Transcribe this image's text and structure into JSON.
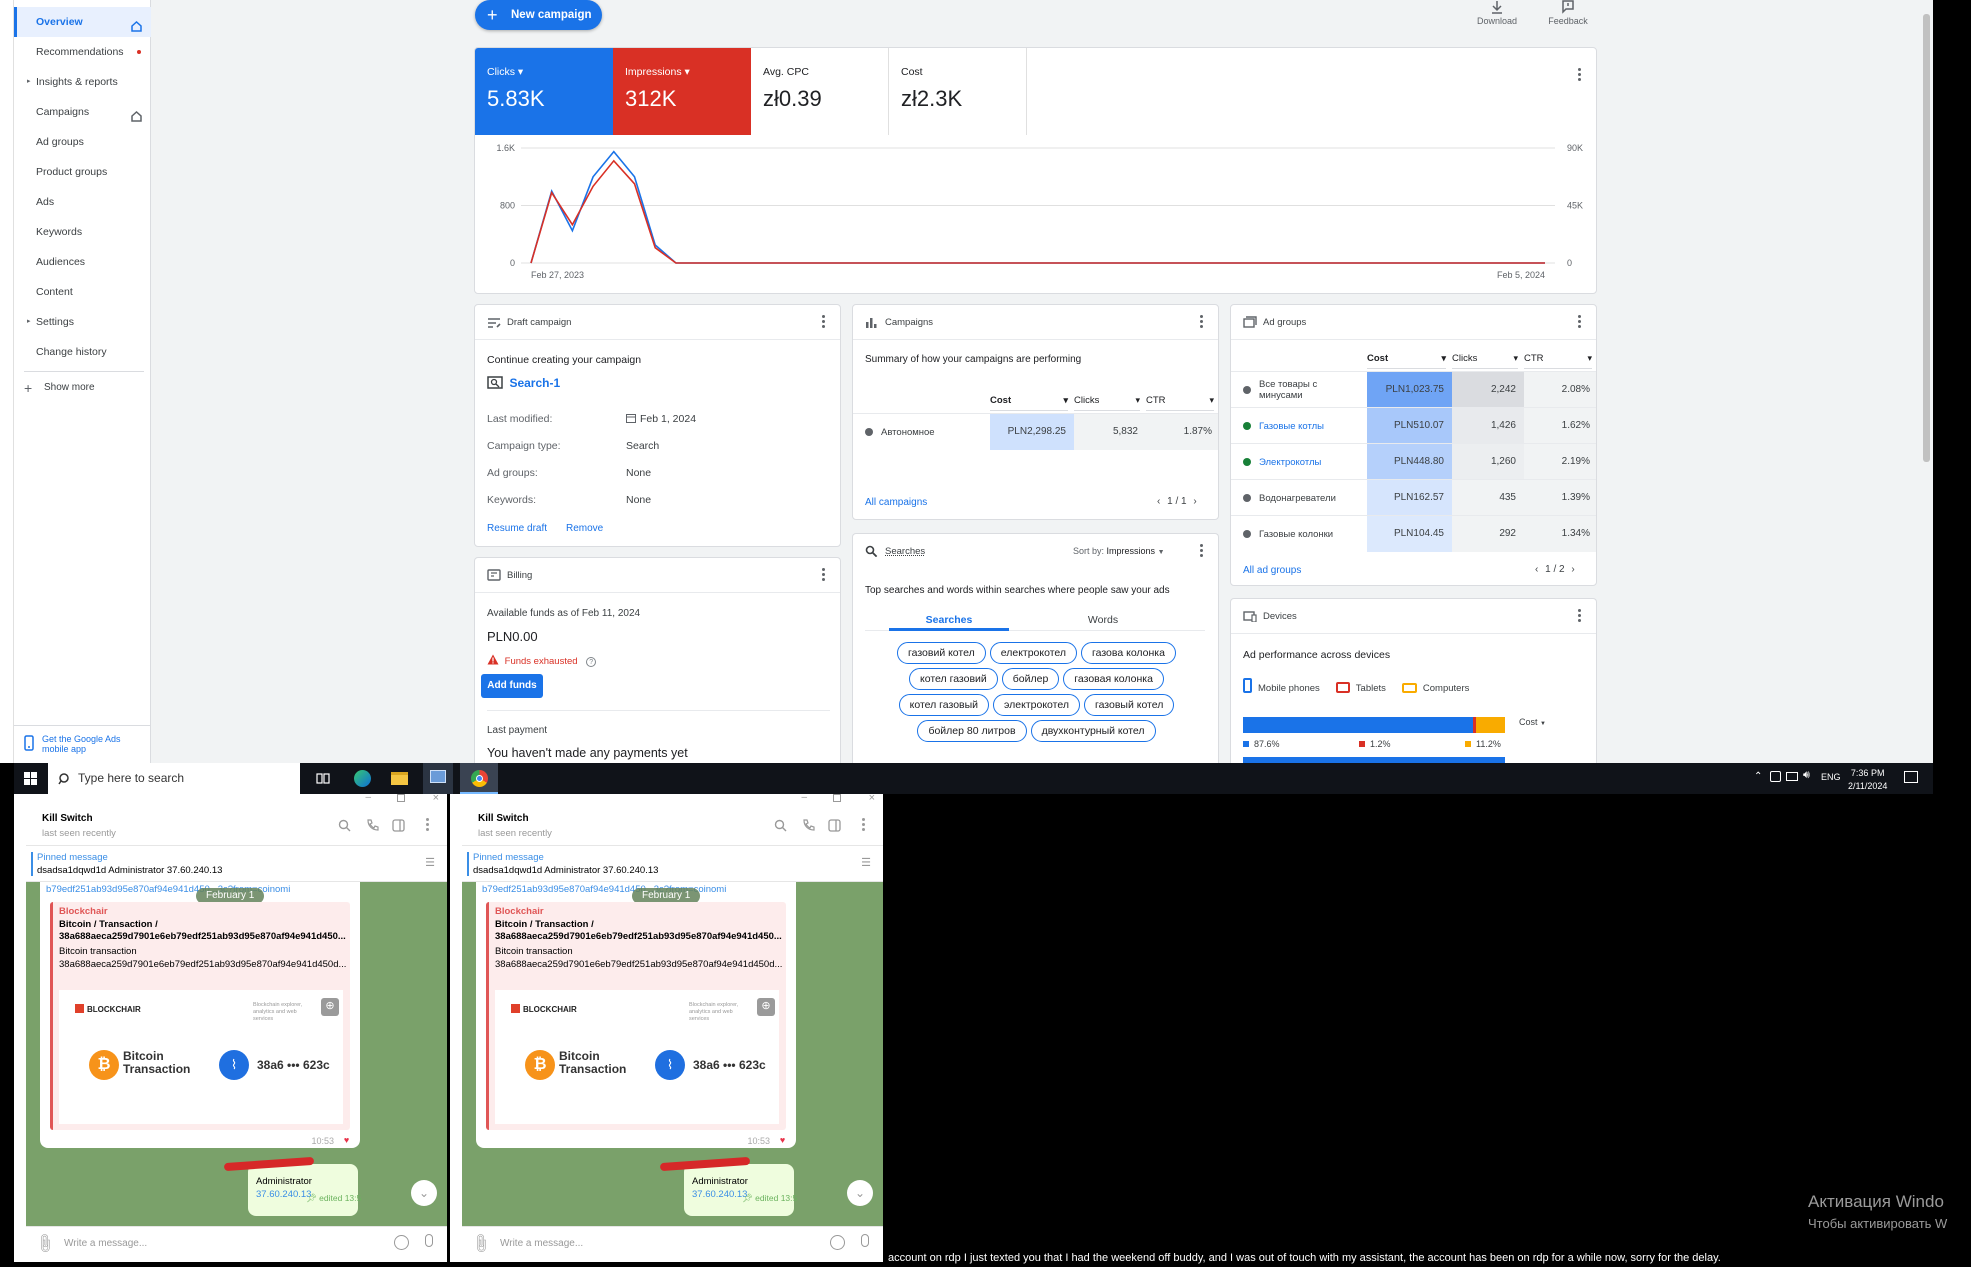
{
  "sidebar": {
    "items": [
      {
        "label": "Overview",
        "active": true,
        "icon": "home-icon"
      },
      {
        "label": "Recommendations",
        "badge": "red-dot"
      },
      {
        "label": "Insights & reports",
        "expandable": true
      },
      {
        "label": "Campaigns",
        "icon": "home-icon"
      },
      {
        "label": "Ad groups"
      },
      {
        "label": "Product groups"
      },
      {
        "label": "Ads"
      },
      {
        "label": "Keywords"
      },
      {
        "label": "Audiences"
      },
      {
        "label": "Content"
      },
      {
        "label": "Settings",
        "expandable": true
      },
      {
        "label": "Change history"
      }
    ],
    "show_more": "Show more",
    "app_promo": "Get the Google Ads mobile app"
  },
  "toolbar": {
    "new_campaign": "New campaign",
    "download": "Download",
    "feedback": "Feedback"
  },
  "metrics": [
    {
      "label": "Clicks",
      "value": "5.83K",
      "color": "#1a73e8",
      "dropdown": true
    },
    {
      "label": "Impressions",
      "value": "312K",
      "color": "#d93025",
      "dropdown": true
    },
    {
      "label": "Avg. CPC",
      "value": "zł0.39"
    },
    {
      "label": "Cost",
      "value": "zł2.3K"
    }
  ],
  "chart_data": {
    "type": "line",
    "x_start_label": "Feb 27, 2023",
    "x_end_label": "Feb 5, 2024",
    "y_left_ticks": [
      "1.6K",
      "800",
      "0"
    ],
    "y_right_ticks": [
      "90K",
      "45K",
      "0"
    ],
    "y_left_range": [
      0,
      1600
    ],
    "y_right_range": [
      0,
      90000
    ],
    "series": [
      {
        "name": "Clicks",
        "color": "#1a73e8",
        "axis": "left",
        "values": [
          0,
          1000,
          450,
          1200,
          1550,
          1200,
          250,
          0,
          0,
          0,
          0,
          0,
          0,
          0,
          0,
          0,
          0,
          0,
          0,
          0,
          0,
          0,
          0,
          0,
          0,
          0,
          0,
          0,
          0,
          0,
          0,
          0,
          0,
          0,
          0,
          0,
          0,
          0,
          0,
          0,
          0,
          0,
          0,
          0,
          0,
          0,
          0,
          0,
          0,
          0
        ]
      },
      {
        "name": "Impressions",
        "color": "#d93025",
        "axis": "right",
        "values": [
          0,
          55000,
          30000,
          60000,
          80000,
          62000,
          12000,
          0,
          0,
          0,
          0,
          0,
          0,
          0,
          0,
          0,
          0,
          0,
          0,
          0,
          0,
          0,
          0,
          0,
          0,
          0,
          0,
          0,
          0,
          0,
          0,
          0,
          0,
          0,
          0,
          0,
          0,
          0,
          0,
          0,
          0,
          0,
          0,
          0,
          0,
          0,
          0,
          0,
          0,
          0
        ]
      }
    ]
  },
  "draft": {
    "title": "Draft campaign",
    "heading": "Continue creating your campaign",
    "name": "Search-1",
    "rows": [
      {
        "label": "Last modified:",
        "value": "Feb 1, 2024"
      },
      {
        "label": "Campaign type:",
        "value": "Search"
      },
      {
        "label": "Ad groups:",
        "value": "None"
      },
      {
        "label": "Keywords:",
        "value": "None"
      }
    ],
    "resume": "Resume draft",
    "remove": "Remove"
  },
  "billing": {
    "title": "Billing",
    "funds_label": "Available funds as of Feb 11, 2024",
    "funds_value": "PLN0.00",
    "warning": "Funds exhausted",
    "add_funds": "Add funds",
    "last_payment_label": "Last payment",
    "last_payment_value": "You haven't made any payments yet"
  },
  "campaigns": {
    "title": "Campaigns",
    "summary": "Summary of how your campaigns are performing",
    "columns": [
      "Cost",
      "Clicks",
      "CTR"
    ],
    "rows": [
      {
        "name": "Автономное",
        "cost": "PLN2,298.25",
        "clicks": "5,832",
        "ctr": "1.87%"
      }
    ],
    "all_link": "All campaigns",
    "pager": "1 / 1"
  },
  "searches": {
    "title": "Searches",
    "sort_label": "Sort by:",
    "sort_value": "Impressions",
    "heading": "Top searches and words within searches where people saw your ads",
    "tabs": [
      "Searches",
      "Words"
    ],
    "chips": [
      [
        "газовий котел",
        "електрокотел",
        "газова колонка"
      ],
      [
        "котел газовий",
        "бойлер",
        "газовая колонка"
      ],
      [
        "котел газовый",
        "электрокотел",
        "газовый котел"
      ],
      [
        "бойлер 80 литров",
        "двухконтурный котел"
      ]
    ]
  },
  "adgroups": {
    "title": "Ad groups",
    "columns": [
      "Cost",
      "Clicks",
      "CTR"
    ],
    "rows": [
      {
        "name": "Все товары с минусами",
        "status": "#5f6368",
        "link": false,
        "cost": "PLN1,023.75",
        "clicks": "2,242",
        "ctr": "2.08%"
      },
      {
        "name": "Газовые котлы",
        "status": "#188038",
        "link": true,
        "cost": "PLN510.07",
        "clicks": "1,426",
        "ctr": "1.62%"
      },
      {
        "name": "Электрокотлы",
        "status": "#188038",
        "link": true,
        "cost": "PLN448.80",
        "clicks": "1,260",
        "ctr": "2.19%"
      },
      {
        "name": "Водонагреватели",
        "status": "#5f6368",
        "link": false,
        "cost": "PLN162.57",
        "clicks": "435",
        "ctr": "1.39%"
      },
      {
        "name": "Газовые колонки",
        "status": "#5f6368",
        "link": false,
        "cost": "PLN104.45",
        "clicks": "292",
        "ctr": "1.34%"
      }
    ],
    "all_link": "All ad groups",
    "pager": "1 / 2"
  },
  "devices": {
    "title": "Devices",
    "heading": "Ad performance across devices",
    "legend": [
      {
        "label": "Mobile phones",
        "color": "#1a73e8"
      },
      {
        "label": "Tablets",
        "color": "#d93025"
      },
      {
        "label": "Computers",
        "color": "#f9ab00"
      }
    ],
    "metric": "Cost",
    "shares": [
      "87.6%",
      "1.2%",
      "11.2%"
    ],
    "share_values": [
      87.6,
      1.2,
      11.2
    ]
  },
  "taskbar": {
    "search_placeholder": "Type here to search",
    "lang": "ENG",
    "time": "7:36 PM",
    "date": "2/11/2024"
  },
  "telegram": {
    "name": "Kill Switch",
    "status": "last seen recently",
    "pinned_label": "Pinned message",
    "pinned_text": "dsadsa1dqwd1d Administrator 37.60.240.13",
    "link_text": "b79edf251ab93d95e870af94e941d450...3c?from=coinomi",
    "date": "February 1",
    "embed_site": "Blockchair",
    "embed_title": "Bitcoin / Transaction / 38a688aeca259d7901e6eb79edf251ab93d95e870af94e941d450...",
    "embed_desc": "Bitcoin transaction",
    "embed_hash": "38a688aeca259d7901e6eb79edf251ab93d95e870af94e941d450d...",
    "embed_brand": "BLOCKCHAIR",
    "embed_tagline": "Blockchain explorer, analytics and web services",
    "card_title": "Bitcoin Transaction",
    "card_hash": "38a6 ••• 623c",
    "msg_time": "10:53",
    "out_line1": "Administrator",
    "out_line2": "37.60.240.13",
    "out_edited": "edited 13:5",
    "input_placeholder": "Write a message..."
  },
  "overlay": {
    "activation_title": "Активация Windo",
    "activation_sub": "Чтобы активировать W",
    "chat_message": "account on rdp I just texted you that I had the weekend off buddy, and I was out of touch with my assistant, the account has been on rdp for a while now, sorry for the delay."
  }
}
